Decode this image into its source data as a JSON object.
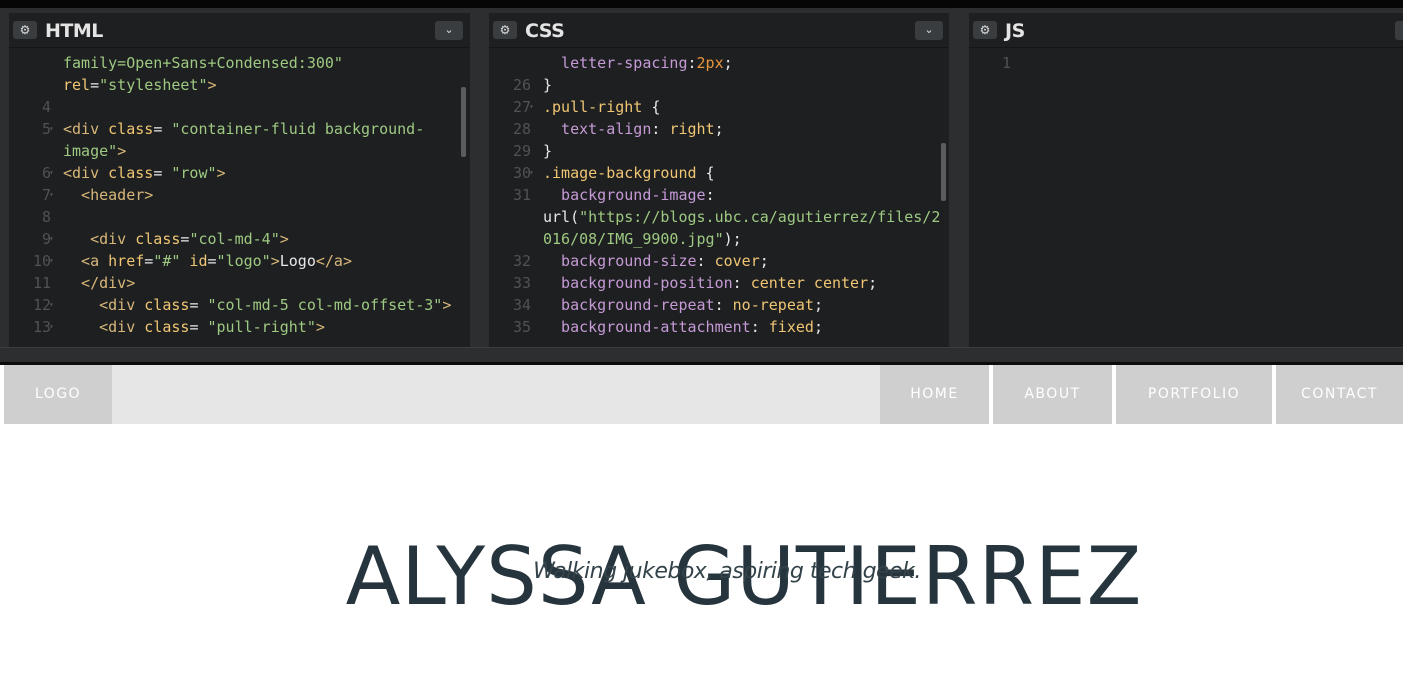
{
  "editor": {
    "panes": [
      {
        "title": "HTML",
        "settings_icon": "gear-icon",
        "menu_icon": "chevron-down-icon"
      },
      {
        "title": "CSS",
        "settings_icon": "gear-icon",
        "menu_icon": "chevron-down-icon"
      },
      {
        "title": "JS",
        "settings_icon": "gear-icon"
      }
    ],
    "html_lines": [
      {
        "num": "",
        "fold": false,
        "tokens": [
          {
            "t": "t-str",
            "v": "family=Open+Sans+Condensed:300\""
          }
        ]
      },
      {
        "num": "",
        "fold": false,
        "tokens": [
          {
            "t": "t-attr",
            "v": "rel"
          },
          {
            "t": "t-plain",
            "v": "="
          },
          {
            "t": "t-str",
            "v": "\"stylesheet\""
          },
          {
            "t": "t-tag",
            "v": ">"
          }
        ]
      },
      {
        "num": "4",
        "fold": false,
        "tokens": []
      },
      {
        "num": "5",
        "fold": true,
        "tokens": [
          {
            "t": "t-tag",
            "v": "<div "
          },
          {
            "t": "t-attr",
            "v": "class"
          },
          {
            "t": "t-plain",
            "v": "= "
          },
          {
            "t": "t-str",
            "v": "\"container-fluid background-"
          }
        ]
      },
      {
        "num": "",
        "fold": false,
        "tokens": [
          {
            "t": "t-str",
            "v": "image\""
          },
          {
            "t": "t-tag",
            "v": ">"
          }
        ]
      },
      {
        "num": "6",
        "fold": true,
        "tokens": [
          {
            "t": "t-tag",
            "v": "<div "
          },
          {
            "t": "t-attr",
            "v": "class"
          },
          {
            "t": "t-plain",
            "v": "= "
          },
          {
            "t": "t-str",
            "v": "\"row\""
          },
          {
            "t": "t-tag",
            "v": ">"
          }
        ]
      },
      {
        "num": "7",
        "fold": true,
        "tokens": [
          {
            "t": "t-tag",
            "v": "  <header>"
          }
        ]
      },
      {
        "num": "8",
        "fold": false,
        "tokens": []
      },
      {
        "num": "9",
        "fold": true,
        "tokens": [
          {
            "t": "t-tag",
            "v": "   <div "
          },
          {
            "t": "t-attr",
            "v": "class"
          },
          {
            "t": "t-plain",
            "v": "="
          },
          {
            "t": "t-str",
            "v": "\"col-md-4\""
          },
          {
            "t": "t-tag",
            "v": ">"
          }
        ]
      },
      {
        "num": "10",
        "fold": true,
        "tokens": [
          {
            "t": "t-tag",
            "v": "  <a "
          },
          {
            "t": "t-attr",
            "v": "href"
          },
          {
            "t": "t-plain",
            "v": "="
          },
          {
            "t": "t-str",
            "v": "\"#\""
          },
          {
            "t": "t-attr",
            "v": " id"
          },
          {
            "t": "t-plain",
            "v": "="
          },
          {
            "t": "t-str",
            "v": "\"logo\""
          },
          {
            "t": "t-tag",
            "v": ">"
          },
          {
            "t": "t-plain",
            "v": "Logo"
          },
          {
            "t": "t-tag",
            "v": "</a>"
          }
        ]
      },
      {
        "num": "11",
        "fold": false,
        "tokens": [
          {
            "t": "t-tag",
            "v": "  </div>"
          }
        ]
      },
      {
        "num": "12",
        "fold": true,
        "tokens": [
          {
            "t": "t-tag",
            "v": "    <div "
          },
          {
            "t": "t-attr",
            "v": "class"
          },
          {
            "t": "t-plain",
            "v": "= "
          },
          {
            "t": "t-str",
            "v": "\"col-md-5 col-md-offset-3\""
          },
          {
            "t": "t-tag",
            "v": ">"
          }
        ]
      },
      {
        "num": "13",
        "fold": true,
        "tokens": [
          {
            "t": "t-tag",
            "v": "    <div "
          },
          {
            "t": "t-attr",
            "v": "class"
          },
          {
            "t": "t-plain",
            "v": "= "
          },
          {
            "t": "t-str",
            "v": "\"pull-right\""
          },
          {
            "t": "t-tag",
            "v": ">"
          }
        ]
      }
    ],
    "css_lines": [
      {
        "num": "",
        "fold": false,
        "tokens": [
          {
            "t": "t-prop",
            "v": "  letter-spacing"
          },
          {
            "t": "t-plain",
            "v": ":"
          },
          {
            "t": "t-num",
            "v": "2px"
          },
          {
            "t": "t-plain",
            "v": ";"
          }
        ]
      },
      {
        "num": "26",
        "fold": false,
        "tokens": [
          {
            "t": "t-plain",
            "v": "}"
          }
        ]
      },
      {
        "num": "27",
        "fold": true,
        "tokens": [
          {
            "t": "t-sel",
            "v": ".pull-right"
          },
          {
            "t": "t-plain",
            "v": " {"
          }
        ]
      },
      {
        "num": "28",
        "fold": false,
        "tokens": [
          {
            "t": "t-prop",
            "v": "  text-align"
          },
          {
            "t": "t-plain",
            "v": ": "
          },
          {
            "t": "t-val",
            "v": "right"
          },
          {
            "t": "t-plain",
            "v": ";"
          }
        ]
      },
      {
        "num": "29",
        "fold": false,
        "tokens": [
          {
            "t": "t-plain",
            "v": "}"
          }
        ]
      },
      {
        "num": "30",
        "fold": true,
        "tokens": [
          {
            "t": "t-sel",
            "v": ".image-background"
          },
          {
            "t": "t-plain",
            "v": " {"
          }
        ]
      },
      {
        "num": "31",
        "fold": false,
        "tokens": [
          {
            "t": "t-prop",
            "v": "  background-image"
          },
          {
            "t": "t-plain",
            "v": ":"
          }
        ]
      },
      {
        "num": "",
        "fold": false,
        "tokens": [
          {
            "t": "t-plain",
            "v": "url("
          },
          {
            "t": "t-str",
            "v": "\"https://blogs.ubc.ca/agutierrez/files/2"
          }
        ]
      },
      {
        "num": "",
        "fold": false,
        "tokens": [
          {
            "t": "t-str",
            "v": "016/08/IMG_9900.jpg\""
          },
          {
            "t": "t-plain",
            "v": ");"
          }
        ]
      },
      {
        "num": "32",
        "fold": false,
        "tokens": [
          {
            "t": "t-prop",
            "v": "  background-size"
          },
          {
            "t": "t-plain",
            "v": ": "
          },
          {
            "t": "t-val",
            "v": "cover"
          },
          {
            "t": "t-plain",
            "v": ";"
          }
        ]
      },
      {
        "num": "33",
        "fold": false,
        "tokens": [
          {
            "t": "t-prop",
            "v": "  background-position"
          },
          {
            "t": "t-plain",
            "v": ": "
          },
          {
            "t": "t-val",
            "v": "center center"
          },
          {
            "t": "t-plain",
            "v": ";"
          }
        ]
      },
      {
        "num": "34",
        "fold": false,
        "tokens": [
          {
            "t": "t-prop",
            "v": "  background-repeat"
          },
          {
            "t": "t-plain",
            "v": ": "
          },
          {
            "t": "t-val",
            "v": "no-repeat"
          },
          {
            "t": "t-plain",
            "v": ";"
          }
        ]
      },
      {
        "num": "35",
        "fold": false,
        "tokens": [
          {
            "t": "t-prop",
            "v": "  background-attachment"
          },
          {
            "t": "t-plain",
            "v": ": "
          },
          {
            "t": "t-val",
            "v": "fixed"
          },
          {
            "t": "t-plain",
            "v": ";"
          }
        ]
      }
    ],
    "js_lines": [
      {
        "num": "1",
        "fold": false,
        "tokens": []
      }
    ]
  },
  "preview": {
    "nav": {
      "logo": "LOGO",
      "home": "HOME",
      "about": "ABOUT",
      "portfolio": "PORTFOLIO",
      "contact": "CONTACT"
    },
    "hero": {
      "title": "ALYSSA GUTIERREZ",
      "subtitle": "Walking jukebox, aspiring tech geek."
    }
  },
  "colors": {
    "editor_bg": "#1d1f20",
    "nav_bg": "#e6e6e6",
    "nav_button": "#cfcfcf",
    "hero_text": "#26343d"
  }
}
